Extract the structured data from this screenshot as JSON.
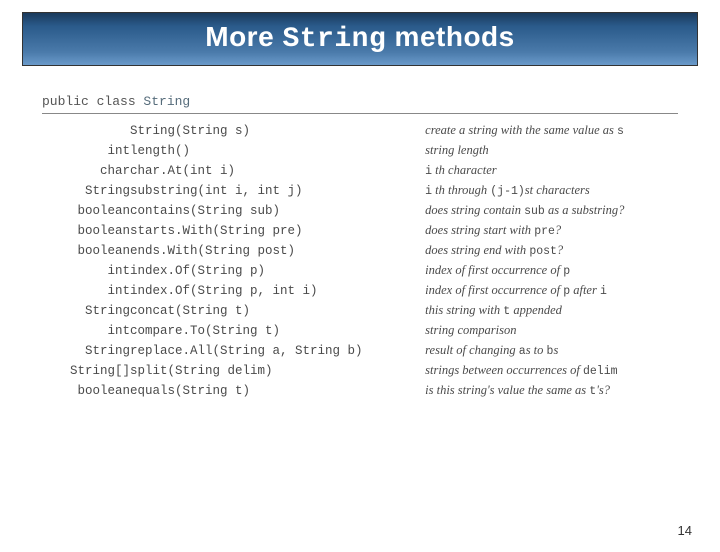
{
  "title": {
    "prefix": "More ",
    "code": "String",
    "suffix": " methods"
  },
  "class_decl": {
    "kw": "public class ",
    "cls": "String"
  },
  "rows": [
    {
      "ret": "",
      "sig": "String(String s)",
      "desc_pre": "create a string with the same value as ",
      "code": "s",
      "desc_post": ""
    },
    {
      "ret": "int",
      "sig": "length()",
      "desc_pre": "string length",
      "code": "",
      "desc_post": ""
    },
    {
      "ret": "char",
      "sig": "char.At(int i)",
      "desc_pre": "",
      "code": "i",
      "desc_post": " th character"
    },
    {
      "ret": "String",
      "sig": "substring(int i, int j)",
      "desc_pre": "",
      "code": "i",
      "desc_post": " th through ",
      "code2": "(j-1)",
      "desc_post2": "st characters"
    },
    {
      "ret": "boolean",
      "sig": "contains(String sub)",
      "desc_pre": "does string contain ",
      "code": "sub",
      "desc_post": " as a substring?"
    },
    {
      "ret": "boolean",
      "sig": "starts.With(String pre)",
      "desc_pre": "does string start with ",
      "code": "pre",
      "desc_post": "?"
    },
    {
      "ret": "boolean",
      "sig": "ends.With(String post)",
      "desc_pre": "does string end with ",
      "code": "post",
      "desc_post": "?"
    },
    {
      "ret": "int",
      "sig": "index.Of(String p)",
      "desc_pre": "index of first occurrence of ",
      "code": "p",
      "desc_post": ""
    },
    {
      "ret": "int",
      "sig": "index.Of(String p, int i)",
      "desc_pre": "index of first occurrence of ",
      "code": "p",
      "desc_post": " after ",
      "code2": "i",
      "desc_post2": ""
    },
    {
      "ret": "String",
      "sig": "concat(String t)",
      "desc_pre": "this string with ",
      "code": "t",
      "desc_post": " appended"
    },
    {
      "ret": "int",
      "sig": "compare.To(String t)",
      "desc_pre": "string comparison",
      "code": "",
      "desc_post": ""
    },
    {
      "ret": "String",
      "sig": "replace.All(String a, String b)",
      "desc_pre": "result of changing ",
      "code": "a",
      "desc_post": "s to ",
      "code2": "b",
      "desc_post2": "s"
    },
    {
      "ret": "String[]",
      "sig": "split(String delim)",
      "desc_pre": "strings between occurrences of ",
      "code": "delim",
      "desc_post": ""
    },
    {
      "ret": "boolean",
      "sig": "equals(String t)",
      "desc_pre": "is this string's value the same as ",
      "code": "t",
      "desc_post": "'s?"
    }
  ],
  "page_number": "14"
}
